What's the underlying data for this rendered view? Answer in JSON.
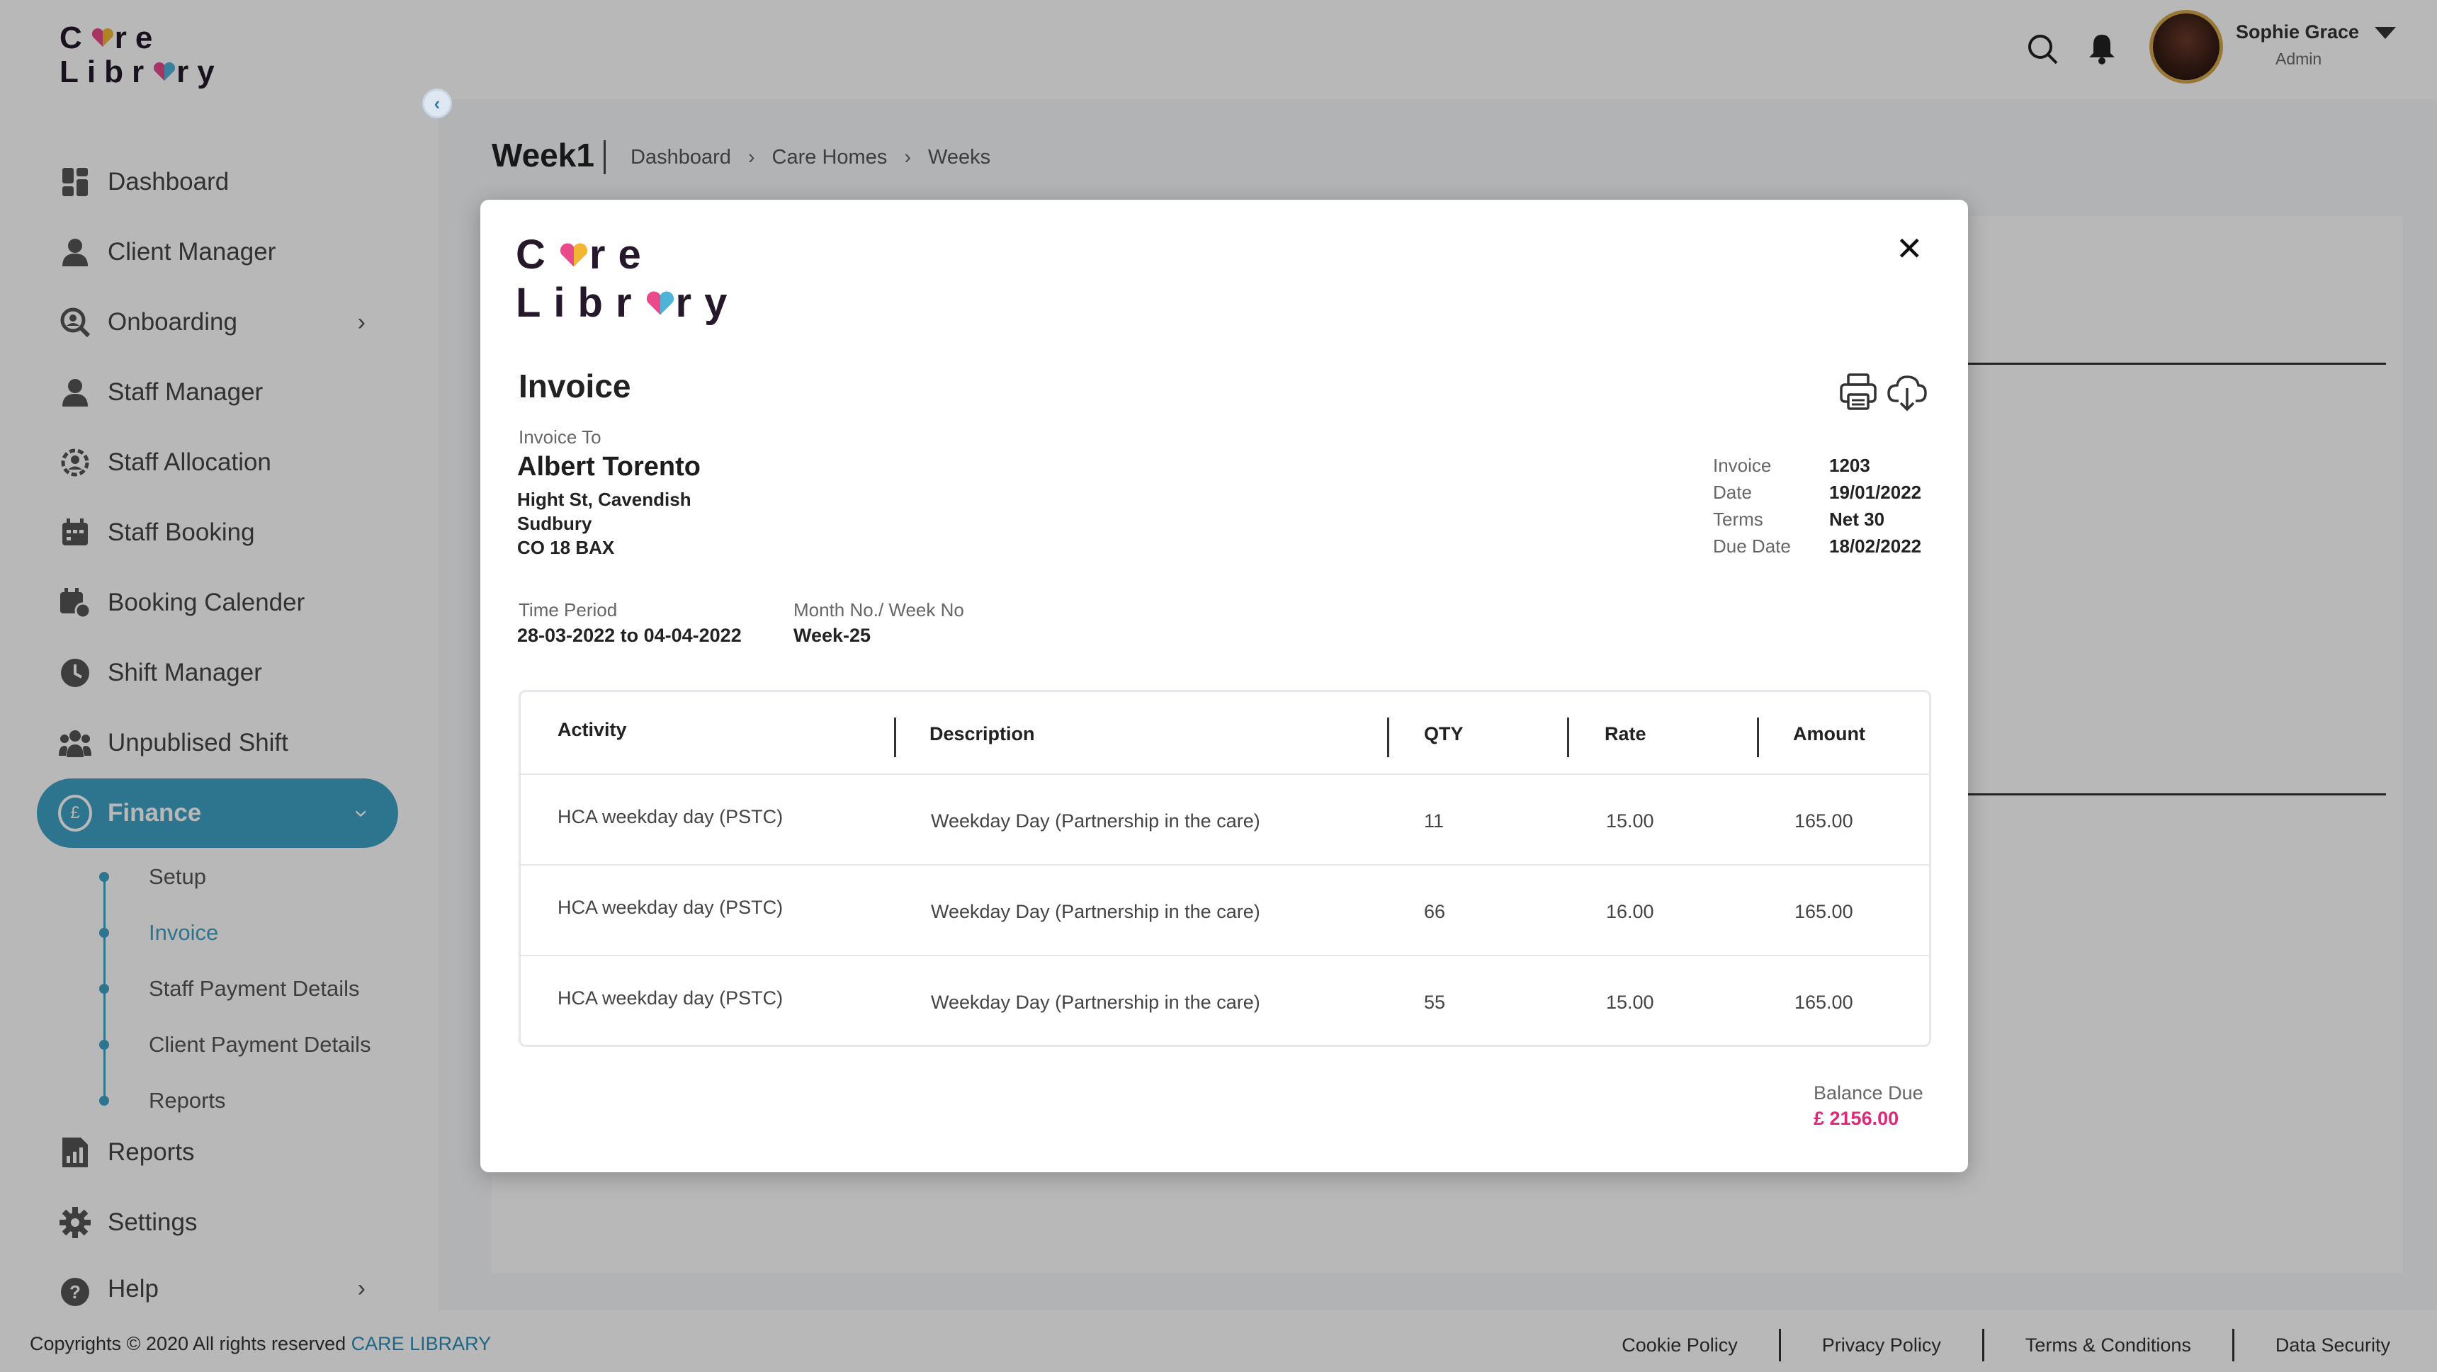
{
  "app": {
    "logo_line1_a": "C",
    "logo_line1_b": "re",
    "logo_line2_a": "Libr",
    "logo_line2_b": "ry"
  },
  "colors": {
    "accent": "#3fa3c5",
    "balance": "#e0287b",
    "heart_left": "#e84a8a",
    "heart_right": "#f2b534",
    "heart_mid": "#4fb3d9"
  },
  "sidebar": {
    "items": [
      {
        "label": "Dashboard",
        "icon": "dashboard-icon"
      },
      {
        "label": "Client Manager",
        "icon": "client-icon"
      },
      {
        "label": "Onboarding",
        "icon": "onboarding-icon"
      },
      {
        "label": "Staff Manager",
        "icon": "staff-icon"
      },
      {
        "label": "Staff Allocation",
        "icon": "allocation-icon"
      },
      {
        "label": "Staff Booking",
        "icon": "booking-icon"
      },
      {
        "label": "Booking Calender",
        "icon": "calendar-icon"
      },
      {
        "label": "Shift Manager",
        "icon": "clock-icon"
      },
      {
        "label": "Unpublised Shift",
        "icon": "people-icon"
      },
      {
        "label": "Finance",
        "icon": "pound-icon"
      },
      {
        "label": "Reports",
        "icon": "report-icon"
      },
      {
        "label": "Settings",
        "icon": "gear-icon"
      },
      {
        "label": "Help",
        "icon": "help-icon"
      }
    ],
    "finance_sub": [
      "Setup",
      "Invoice",
      "Staff Payment Details",
      "Client Payment Details",
      "Reports"
    ],
    "finance_symbol": "£"
  },
  "header": {
    "user_name": "Sophie Grace",
    "user_role": "Admin"
  },
  "page": {
    "title": "Week1",
    "breadcrumb": [
      "Dashboard",
      "Care Homes",
      "Weeks"
    ]
  },
  "invoice": {
    "title": "Invoice",
    "to_label": "Invoice To",
    "to_name": "Albert Torento",
    "address": [
      "Hight St, Cavendish",
      "Sudbury",
      "CO 18 BAX"
    ],
    "meta": [
      {
        "key": "Invoice",
        "value": "1203"
      },
      {
        "key": "Date",
        "value": "19/01/2022"
      },
      {
        "key": "Terms",
        "value": "Net 30"
      },
      {
        "key": "Due Date",
        "value": "18/02/2022"
      }
    ],
    "time_period_label": "Time Period",
    "time_period_value": "28-03-2022 to 04-04-2022",
    "week_label": "Month No./ Week No",
    "week_value": "Week-25",
    "columns": [
      "Activity",
      "Description",
      "QTY",
      "Rate",
      "Amount"
    ],
    "rows": [
      {
        "activity": "HCA weekday day (PSTC)",
        "description": "Weekday Day (Partnership in the care)",
        "qty": "11",
        "rate": "15.00",
        "amount": "165.00"
      },
      {
        "activity": "HCA weekday day (PSTC)",
        "description": "Weekday Day (Partnership in the care)",
        "qty": "66",
        "rate": "16.00",
        "amount": "165.00"
      },
      {
        "activity": "HCA weekday day (PSTC)",
        "description": "Weekday Day (Partnership in the care)",
        "qty": "55",
        "rate": "15.00",
        "amount": "165.00"
      }
    ],
    "balance_label": "Balance Due",
    "balance_value": "£ 2156.00"
  },
  "footer": {
    "copyright": "Copyrights © 2020  All rights reserved ",
    "brand": "CARE LIBRARY",
    "links": [
      "Cookie Policy",
      "Privacy Policy",
      "Terms & Conditions",
      "Data Security"
    ]
  }
}
